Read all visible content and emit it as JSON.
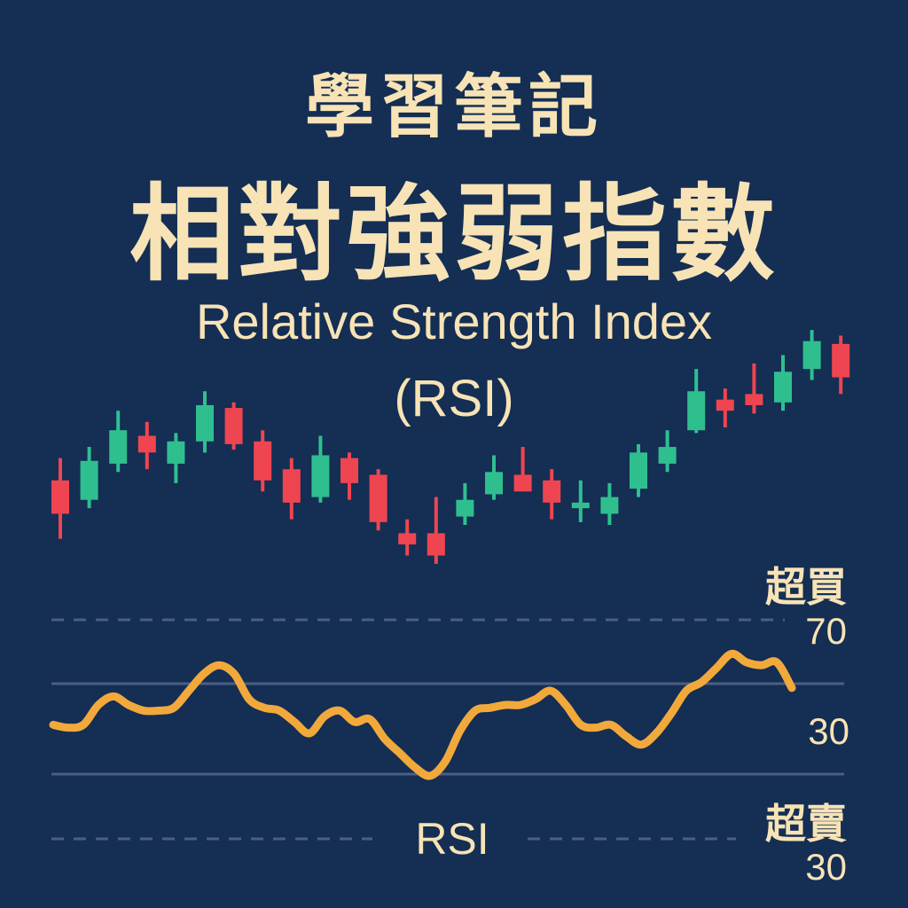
{
  "header": {
    "title_small": "學習筆記",
    "title_big": "相對強弱指數",
    "subtitle_en": "Relative Strength Index",
    "subtitle_abbr": "(RSI)"
  },
  "colors": {
    "background": "#142e54",
    "text": "#f7e3b5",
    "up": "#2fbf8f",
    "down": "#ef4550",
    "rsi_line": "#f2a93b",
    "guide": "#4a5f82"
  },
  "chart_data": [
    {
      "type": "candlestick",
      "title": "",
      "up_color": "#2fbf8f",
      "down_color": "#ef4550",
      "candles": [
        {
          "open": 52,
          "close": 40,
          "high": 60,
          "low": 31
        },
        {
          "open": 45,
          "close": 59,
          "high": 64,
          "low": 42
        },
        {
          "open": 58,
          "close": 70,
          "high": 77,
          "low": 55
        },
        {
          "open": 68,
          "close": 62,
          "high": 73,
          "low": 56
        },
        {
          "open": 58,
          "close": 66,
          "high": 69,
          "low": 51
        },
        {
          "open": 66,
          "close": 79,
          "high": 84,
          "low": 62
        },
        {
          "open": 78,
          "close": 65,
          "high": 80,
          "low": 63
        },
        {
          "open": 66,
          "close": 52,
          "high": 70,
          "low": 48
        },
        {
          "open": 56,
          "close": 44,
          "high": 60,
          "low": 38
        },
        {
          "open": 46,
          "close": 61,
          "high": 68,
          "low": 44
        },
        {
          "open": 60,
          "close": 51,
          "high": 62,
          "low": 45
        },
        {
          "open": 54,
          "close": 37,
          "high": 56,
          "low": 34
        },
        {
          "open": 33,
          "close": 29,
          "high": 38,
          "low": 25
        },
        {
          "open": 33,
          "close": 25,
          "high": 46,
          "low": 22
        },
        {
          "open": 39,
          "close": 45,
          "high": 51,
          "low": 36
        },
        {
          "open": 47,
          "close": 55,
          "high": 61,
          "low": 45
        },
        {
          "open": 54,
          "close": 48,
          "high": 64,
          "low": 50
        },
        {
          "open": 52,
          "close": 44,
          "high": 56,
          "low": 38
        },
        {
          "open": 42,
          "close": 44,
          "high": 52,
          "low": 37
        },
        {
          "open": 40,
          "close": 46,
          "high": 51,
          "low": 36
        },
        {
          "open": 49,
          "close": 62,
          "high": 65,
          "low": 46
        },
        {
          "open": 58,
          "close": 64,
          "high": 70,
          "low": 55
        },
        {
          "open": 70,
          "close": 84,
          "high": 92,
          "low": 69
        },
        {
          "open": 81,
          "close": 77,
          "high": 85,
          "low": 71
        },
        {
          "open": 83,
          "close": 79,
          "high": 94,
          "low": 76
        },
        {
          "open": 80,
          "close": 91,
          "high": 97,
          "low": 77
        },
        {
          "open": 92,
          "close": 102,
          "high": 106,
          "low": 88
        },
        {
          "open": 101,
          "close": 89,
          "high": 104,
          "low": 83
        }
      ]
    },
    {
      "type": "line",
      "title": "",
      "xlabel": "RSI",
      "ylabel": "",
      "ylim": [
        0,
        100
      ],
      "grid": false,
      "reference_lines": [
        {
          "value": 70,
          "label": "70",
          "zone_label": "超買",
          "style": "dashed"
        },
        {
          "value": 30,
          "label": "30",
          "zone_label": "超賣",
          "style": "dashed"
        }
      ],
      "series": [
        {
          "name": "RSI",
          "x": [
            0,
            1,
            2,
            3,
            4,
            5,
            6,
            7,
            8,
            9,
            10,
            11,
            12,
            13,
            14,
            15,
            16,
            17,
            18,
            19,
            20,
            21,
            22,
            23,
            24,
            25,
            26,
            27,
            28,
            29,
            30,
            31,
            32,
            33,
            34,
            35,
            36,
            37,
            38,
            39,
            40,
            41,
            42,
            43,
            44,
            45,
            46,
            47,
            48,
            49
          ],
          "values": [
            43,
            42,
            43,
            50,
            53,
            50,
            48,
            48,
            49,
            55,
            61,
            64,
            61,
            52,
            49,
            48,
            44,
            40,
            46,
            48,
            44,
            45,
            38,
            33,
            28,
            25,
            30,
            41,
            48,
            49,
            50,
            50,
            52,
            55,
            50,
            43,
            42,
            43,
            39,
            36,
            40,
            47,
            55,
            58,
            63,
            68,
            65,
            64,
            65,
            56
          ]
        }
      ]
    }
  ],
  "labels": {
    "overbought_zone": "超買",
    "overbought_value": "70",
    "rsi_current_value": "30",
    "rsi_axis_label": "RSI",
    "oversold_zone": "超賣",
    "oversold_value": "30"
  }
}
